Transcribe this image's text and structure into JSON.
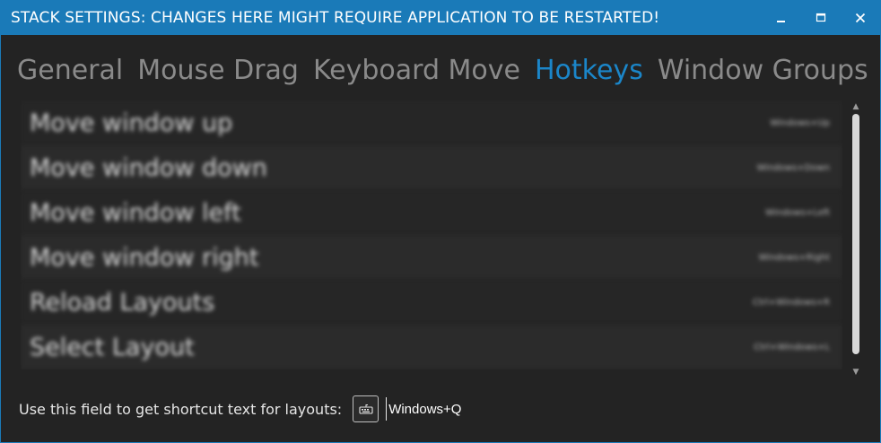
{
  "window": {
    "title": "STACK SETTINGS: CHANGES HERE MIGHT REQUIRE APPLICATION TO BE RESTARTED!",
    "accent": "#1a7ab8",
    "minimize_icon": "minimize-icon",
    "maximize_icon": "maximize-icon",
    "close_icon": "close-icon"
  },
  "tabs": [
    {
      "label": "General",
      "active": false
    },
    {
      "label": "Mouse Drag",
      "active": false
    },
    {
      "label": "Keyboard Move",
      "active": false
    },
    {
      "label": "Hotkeys",
      "active": true
    },
    {
      "label": "Window Groups",
      "active": false
    }
  ],
  "hotkeys": [
    {
      "label": "Move window up",
      "key": "Windows+Up"
    },
    {
      "label": "Move window down",
      "key": "Windows+Down"
    },
    {
      "label": "Move window left",
      "key": "Windows+Left"
    },
    {
      "label": "Move window right",
      "key": "Windows+Right"
    },
    {
      "label": "Reload Layouts",
      "key": "Ctrl+Windows+R"
    },
    {
      "label": "Select Layout",
      "key": "Ctrl+Windows+L"
    }
  ],
  "footer": {
    "label": "Use this field to get shortcut text for layouts:",
    "keyboard_icon": "keyboard-icon",
    "shortcut_value": "Windows+Q"
  }
}
